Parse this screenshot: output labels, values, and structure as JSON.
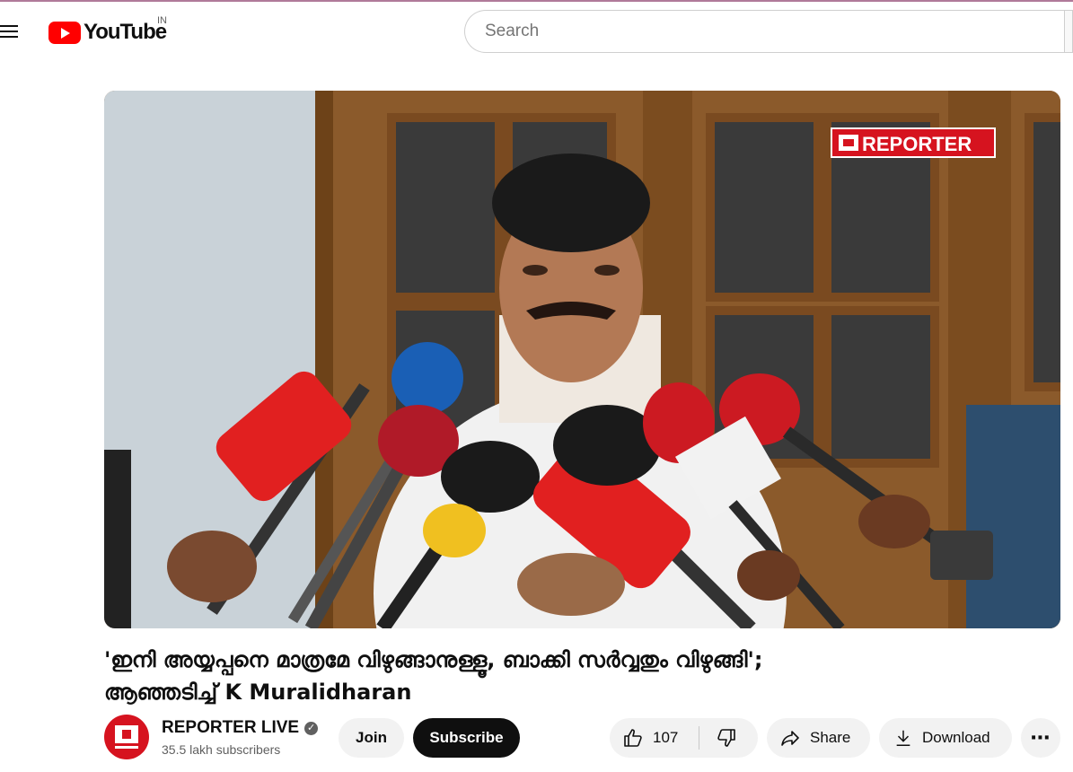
{
  "header": {
    "logo_text": "YouTube",
    "country_code": "IN",
    "search_placeholder": "Search"
  },
  "video": {
    "overlay_logo": "REPORTER",
    "title_line1": "'ഇനി അയ്യപ്പനെ മാത്രമേ വിഴുങ്ങാനുള്ളൂ, ബാക്കി സർവ്വതും വിഴുങ്ങി';",
    "title_line2": "ആഞ്ഞടിച്ച് K Muralidharan"
  },
  "channel": {
    "name": "REPORTER LIVE",
    "verified_icon": "check-icon",
    "subscribers": "35.5 lakh subscribers"
  },
  "actions": {
    "join": "Join",
    "subscribe": "Subscribe",
    "like_count": "107",
    "share": "Share",
    "download": "Download",
    "more": "⋯"
  },
  "colors": {
    "brand_red": "#ff0000",
    "reporter_red": "#d6131f",
    "pill_bg": "#f2f2f2"
  }
}
